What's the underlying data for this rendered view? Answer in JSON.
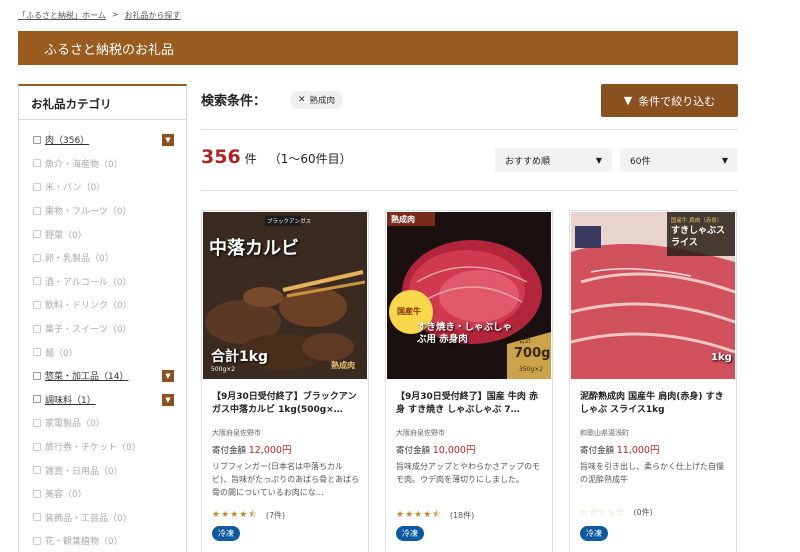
{
  "breadcrumb": {
    "home": "「ふるさと納税」ホーム",
    "sep": ">",
    "current": "お礼品から探す"
  },
  "banner": {
    "title": "ふるさと納税のお礼品"
  },
  "sidebar": {
    "title": "お礼品カテゴリ",
    "items": [
      {
        "label": "肉（356）",
        "active": true,
        "expand": true
      },
      {
        "label": "魚介・海産物（0）",
        "active": false
      },
      {
        "label": "米・パン（0）",
        "active": false
      },
      {
        "label": "果物・フルーツ（0）",
        "active": false
      },
      {
        "label": "野菜（0）",
        "active": false
      },
      {
        "label": "卵・乳製品（0）",
        "active": false
      },
      {
        "label": "酒・アルコール（0）",
        "active": false
      },
      {
        "label": "飲料・ドリンク（0）",
        "active": false
      },
      {
        "label": "菓子・スイーツ（0）",
        "active": false
      },
      {
        "label": "麺（0）",
        "active": false
      },
      {
        "label": "惣菜・加工品（14）",
        "active": true,
        "expand": true
      },
      {
        "label": "調味料（1）",
        "active": true,
        "expand": true
      },
      {
        "label": "家電製品（0）",
        "active": false
      },
      {
        "label": "旅行券・チケット（0）",
        "active": false
      },
      {
        "label": "雑貨・日用品（0）",
        "active": false
      },
      {
        "label": "美容（0）",
        "active": false
      },
      {
        "label": "装飾品・工芸品（0）",
        "active": false
      },
      {
        "label": "花・観葉植物（0）",
        "active": false
      }
    ],
    "expand_icon": "triangle-down-icon"
  },
  "search": {
    "label": "検索条件：",
    "chip": "熟成肉",
    "chip_icon": "close-icon"
  },
  "filter_button": {
    "label": "条件で絞り込む",
    "icon": "triangle-down-icon"
  },
  "results": {
    "count": "356",
    "unit": "件",
    "range": "（1〜60件目）"
  },
  "sort": {
    "selected": "おすすめ順"
  },
  "per_page": {
    "selected": "60件"
  },
  "colors": {
    "accent": "#9a5b1e",
    "button": "#8a5020",
    "price": "#b22222",
    "badge": "#0e5aa0",
    "star": "#c4862c"
  },
  "products": [
    {
      "title": "【9月30日受付終了】ブラックアンガス中落カルビ 1kg(500g×…",
      "location": "大阪府泉佐野市",
      "price_label": "寄付金額",
      "price": "12,000円",
      "description": "リブフィンガー(日本名は中落ちカルビ)、旨味がたっぷりのあばら骨とあばら骨の間についているお肉にな…",
      "stars": 4.5,
      "reviews": "(7件)",
      "badge": "冷凍",
      "image": {
        "tag": "ブラックアンガス",
        "headline": "中落カルビ",
        "corner": "合計1kg",
        "sub": "500g×2",
        "stamp": "熟成肉"
      }
    },
    {
      "title": "【9月30日受付終了】国産 牛肉 赤身 すき焼き しゃぶしゃぶ 7…",
      "location": "大阪府泉佐野市",
      "price_label": "寄付金額",
      "price": "10,000円",
      "description": "旨味成分アップとやわらかさアップのモモ肉。ウデ肉を薄切りにしました。",
      "stars": 4.5,
      "reviews": "(18件)",
      "badge": "冷凍",
      "image": {
        "tag": "熟成肉",
        "seal": "国産牛",
        "headline": "すき焼き・しゃぶしゃぶ用 赤身肉",
        "corner_top": "合計",
        "corner": "700g",
        "sub": "350g×2"
      }
    },
    {
      "title": "泥酔熟成肉 国産牛 肩肉(赤身) すきしゃぶ スライス1kg",
      "location": "和歌山県湯浅町",
      "price_label": "寄付金額",
      "price": "11,000円",
      "description": "旨味を引き出し、柔らかく仕上げた自慢の泥酔熟成牛",
      "stars": 0,
      "reviews": "(0件)",
      "badge": "冷凍",
      "image": {
        "tag": "国産牛 肩肉（赤身）",
        "headline": "すきしゃぶスライス",
        "corner": "1kg"
      }
    }
  ]
}
